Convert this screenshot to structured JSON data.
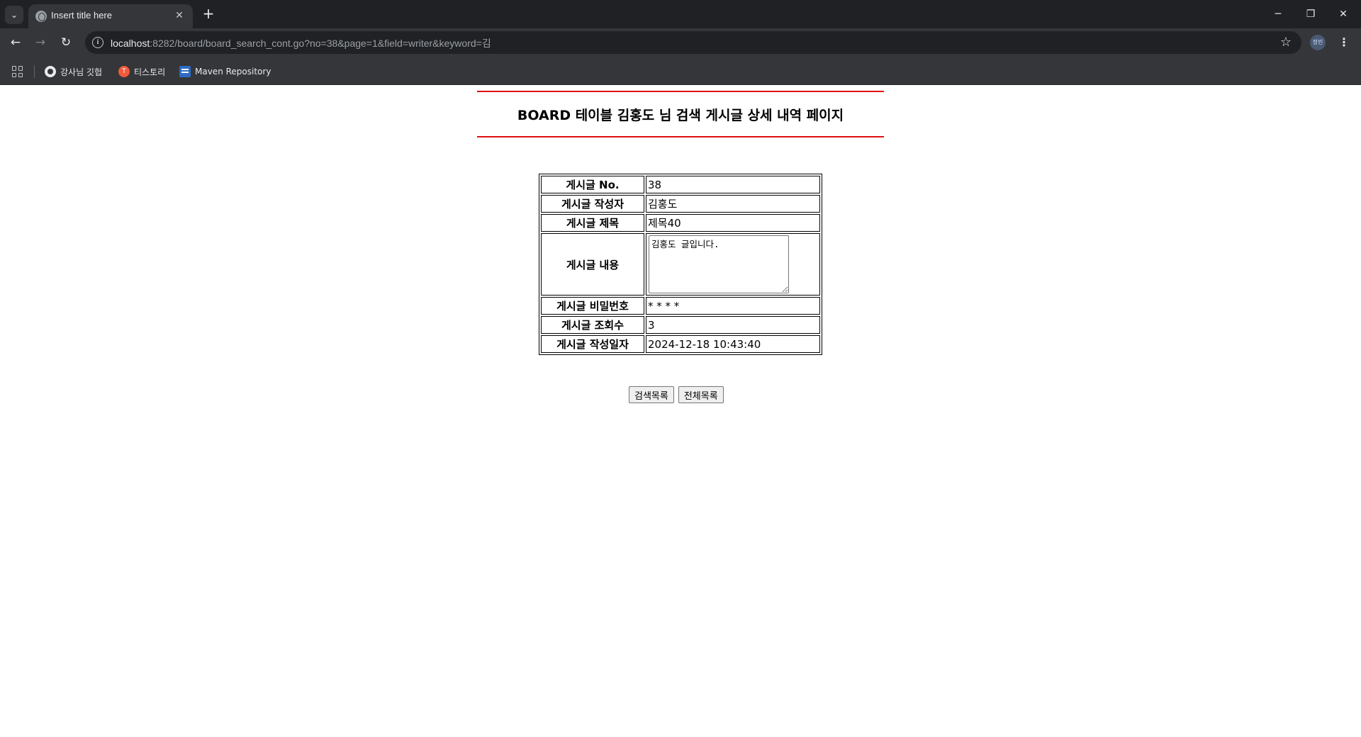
{
  "browser": {
    "tab_title": "Insert title here",
    "url_host": "localhost",
    "url_rest": ":8282/board/board_search_cont.go?no=38&page=1&field=writer&keyword=김",
    "profile_label": "정빈",
    "bookmarks": [
      {
        "label": "강사님 깃헙",
        "icon": "github-icon"
      },
      {
        "label": "티스토리",
        "icon": "tistory-icon"
      },
      {
        "label": "Maven Repository",
        "icon": "maven-icon"
      }
    ]
  },
  "page": {
    "heading": "BOARD 테이블 김홍도 님 검색 게시글 상세 내역 페이지",
    "rows": {
      "no_label": "게시글 No.",
      "no_value": "38",
      "writer_label": "게시글 작성자",
      "writer_value": "김홍도",
      "title_label": "게시글 제목",
      "title_value": "제목40",
      "content_label": "게시글 내용",
      "content_value": "김홍도 글입니다.",
      "pwd_label": "게시글 비밀번호",
      "pwd_value": "* * * *",
      "hit_label": "게시글 조회수",
      "hit_value": "3",
      "date_label": "게시글 작성일자",
      "date_value": "2024-12-18 10:43:40"
    },
    "buttons": {
      "search_list": "검색목록",
      "all_list": "전체목록"
    }
  },
  "colors": {
    "heading_rule": "#e01010",
    "chrome_dark": "#202124",
    "chrome_mid": "#35363a"
  }
}
